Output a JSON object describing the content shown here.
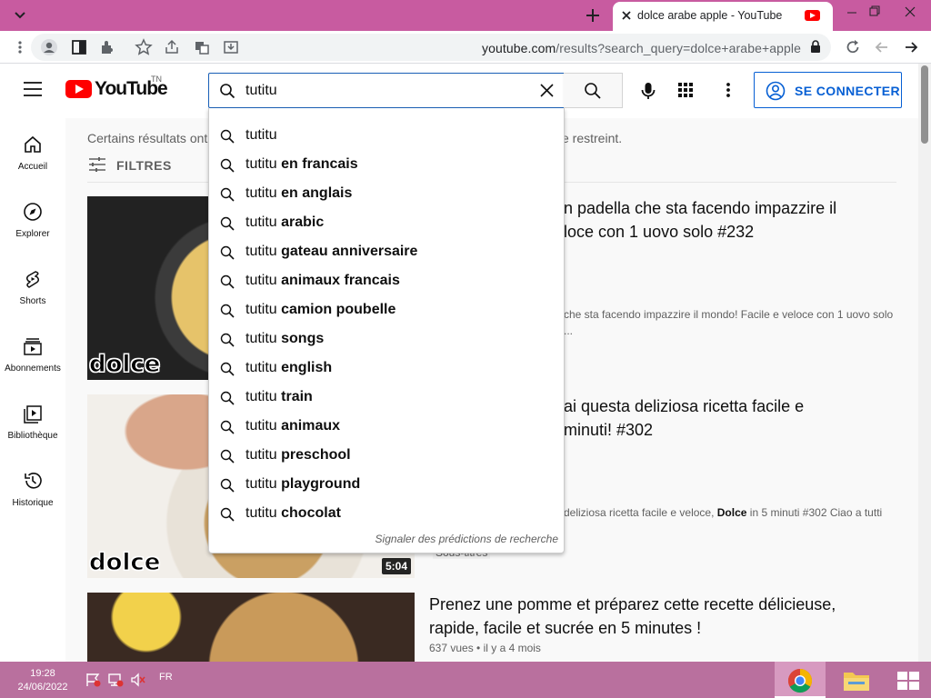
{
  "browser": {
    "tab_title": "dolce arabe apple - YouTube",
    "url_host": "youtube.com",
    "url_path": "/results?search_query=dolce+arabe+apple"
  },
  "masthead": {
    "logo_text": "YouTube",
    "logo_region": "TN",
    "search_value": "tutitu",
    "signin_label": "SE CONNECTER"
  },
  "guide": {
    "items": [
      {
        "label": "Accueil",
        "icon": "home-icon"
      },
      {
        "label": "Explorer",
        "icon": "compass-icon"
      },
      {
        "label": "Shorts",
        "icon": "shorts-icon"
      },
      {
        "label": "Abonnements",
        "icon": "subscriptions-icon"
      },
      {
        "label": "Bibliothèque",
        "icon": "library-icon"
      },
      {
        "label": "Historique",
        "icon": "history-icon"
      }
    ]
  },
  "results": {
    "notice_left": "Certains résultats ont",
    "notice_right": "e restreint.",
    "filters_label": "FILTRES",
    "videos": [
      {
        "title_line1": "n padella che sta facendo impazzire il",
        "title_line2": "loce con 1 uovo solo #232",
        "desc_line1": "che sta facendo impazzire il mondo! Facile e veloce con 1 uovo solo",
        "desc_line2": "...",
        "watermark": "dolce"
      },
      {
        "title_line1": "ai questa deliziosa ricetta facile e",
        "title_line2": "minuti! #302",
        "desc_pre": "deliziosa ricetta facile e veloce, ",
        "desc_bold": "Dolce",
        "desc_post": " in 5 minuti #302 Ciao a tutti",
        "duration": "5:04",
        "watermark": "dolce",
        "subtitle_badge": "Sous-titres"
      },
      {
        "title_line1": "Prenez une pomme et préparez cette recette délicieuse,",
        "title_line2": "rapide, facile et sucrée en 5 minutes !",
        "meta": "637 vues • il y a 4 mois"
      }
    ]
  },
  "suggestions": {
    "prefix": "tutitu",
    "items": [
      {
        "rest": ""
      },
      {
        "rest": " en francais"
      },
      {
        "rest": " en anglais"
      },
      {
        "rest": " arabic"
      },
      {
        "rest": " gateau anniversaire"
      },
      {
        "rest": " animaux francais"
      },
      {
        "rest": " camion poubelle"
      },
      {
        "rest": " songs"
      },
      {
        "rest": " english"
      },
      {
        "rest": " train"
      },
      {
        "rest": " animaux"
      },
      {
        "rest": " preschool"
      },
      {
        "rest": " playground"
      },
      {
        "rest": " chocolat"
      }
    ],
    "report_label": "Signaler des prédictions de recherche"
  },
  "taskbar": {
    "time": "19:28",
    "date": "24/06/2022",
    "language": "FR"
  },
  "colors": {
    "tabbar": "#c85ba0",
    "taskbar": "#b9709e",
    "yt_red": "#ff0000",
    "link_blue": "#065fd4"
  }
}
